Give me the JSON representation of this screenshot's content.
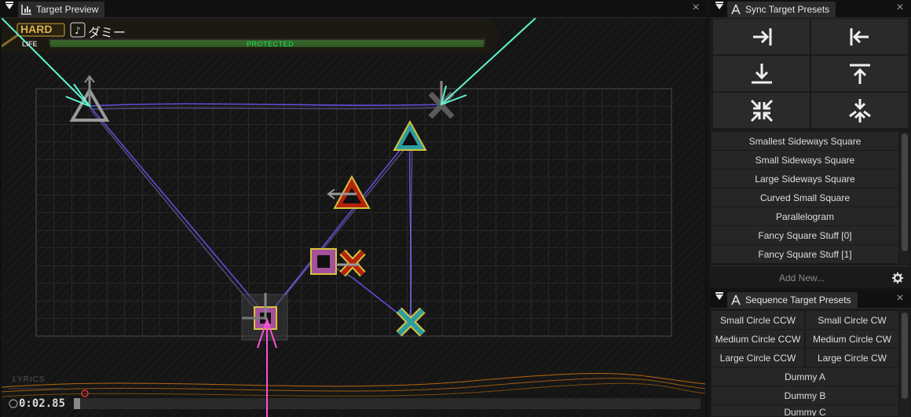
{
  "preview": {
    "tab_label": "Target Preview",
    "difficulty": "HARD",
    "song_title": "ダミー",
    "life_label": "LIFE",
    "life_status": "PROTECTED",
    "lyrics_label": "LYRICS",
    "time": "0:02.85"
  },
  "sync": {
    "tab_label": "Sync Target Presets",
    "presets": [
      "Smallest Sideways Square",
      "Small Sideways Square",
      "Large Sideways Square",
      "Curved Small Square",
      "Parallelogram",
      "Fancy Square Stuff [0]",
      "Fancy Square Stuff [1]"
    ],
    "add_new": "Add New..."
  },
  "sequence": {
    "tab_label": "Sequence Target Presets",
    "pairs": [
      [
        "Small Circle CCW",
        "Small Circle CW"
      ],
      [
        "Medium Circle CCW",
        "Medium Circle CW"
      ],
      [
        "Large Circle CCW",
        "Large Circle CW"
      ]
    ],
    "singles": [
      "Dummy A",
      "Dummy B",
      "Dummy C"
    ]
  },
  "colors": {
    "accent_cyan": "#5ef5d0",
    "accent_pink": "#ff4fd8",
    "target_purple": "#6b5cff",
    "hud_gold": "#c8a23a",
    "life_green": "#3e8f2a"
  }
}
